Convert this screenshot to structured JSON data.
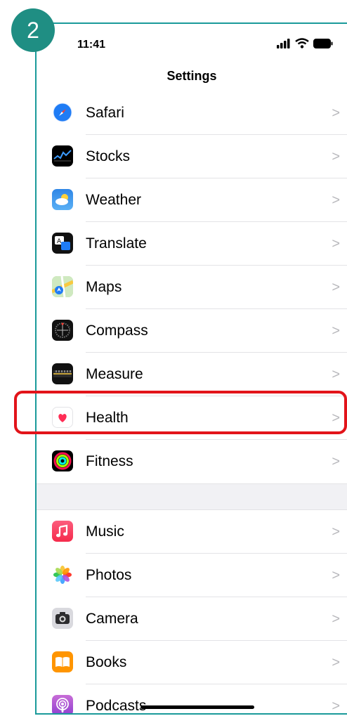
{
  "step_badge": "2",
  "status": {
    "time": "11:41"
  },
  "nav": {
    "title": "Settings"
  },
  "group1": [
    {
      "label": "Safari",
      "icon": "safari-icon"
    },
    {
      "label": "Stocks",
      "icon": "stocks-icon"
    },
    {
      "label": "Weather",
      "icon": "weather-icon"
    },
    {
      "label": "Translate",
      "icon": "translate-icon"
    },
    {
      "label": "Maps",
      "icon": "maps-icon"
    },
    {
      "label": "Compass",
      "icon": "compass-icon"
    },
    {
      "label": "Measure",
      "icon": "measure-icon"
    },
    {
      "label": "Health",
      "icon": "health-icon"
    },
    {
      "label": "Fitness",
      "icon": "fitness-icon"
    }
  ],
  "group2": [
    {
      "label": "Music",
      "icon": "music-icon"
    },
    {
      "label": "Photos",
      "icon": "photos-icon"
    },
    {
      "label": "Camera",
      "icon": "camera-icon"
    },
    {
      "label": "Books",
      "icon": "books-icon"
    },
    {
      "label": "Podcasts",
      "icon": "podcasts-icon"
    }
  ],
  "chevron": ">",
  "highlight_color": "#e2141a",
  "accent_color": "#1f8e83"
}
